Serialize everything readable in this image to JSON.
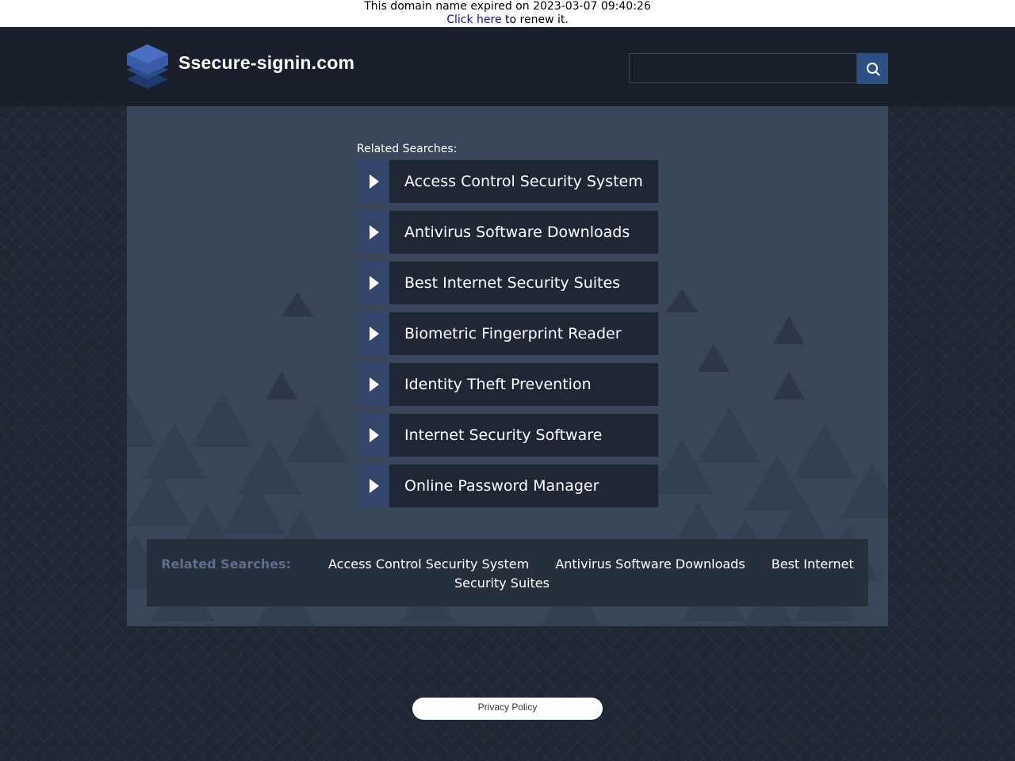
{
  "expiry": {
    "message": "This domain name expired on 2023-03-07 09:40:26",
    "renew_link": "Click here",
    "renew_suffix": " to renew it."
  },
  "header": {
    "logo_text": "Ssecure-signin.com",
    "logo_icon": "stacked-layers-icon",
    "search_placeholder": "",
    "search_icon": "search-icon"
  },
  "main": {
    "related_label": "Related Searches:",
    "links": [
      {
        "label": "Access Control Security System"
      },
      {
        "label": "Antivirus Software Downloads"
      },
      {
        "label": "Best Internet Security Suites"
      },
      {
        "label": "Biometric Fingerprint Reader"
      },
      {
        "label": "Identity Theft Prevention"
      },
      {
        "label": "Internet Security Software"
      },
      {
        "label": "Online Password Manager"
      }
    ]
  },
  "bottom": {
    "related_label": "Related Searches:",
    "links": [
      {
        "label": "Access Control Security System"
      },
      {
        "label": "Antivirus Software Downloads"
      },
      {
        "label": "Best Internet Security Suites"
      }
    ]
  },
  "footer": {
    "privacy_label": "Privacy Policy"
  },
  "colors": {
    "page_bg": "#1e2733",
    "header_bg": "#19202b",
    "panel_bg": "#394559",
    "link_bg": "#1f2734",
    "arrow_bg": "#33456a",
    "search_button": "#2c4f86",
    "bottom_label": "#5b6f8a"
  }
}
